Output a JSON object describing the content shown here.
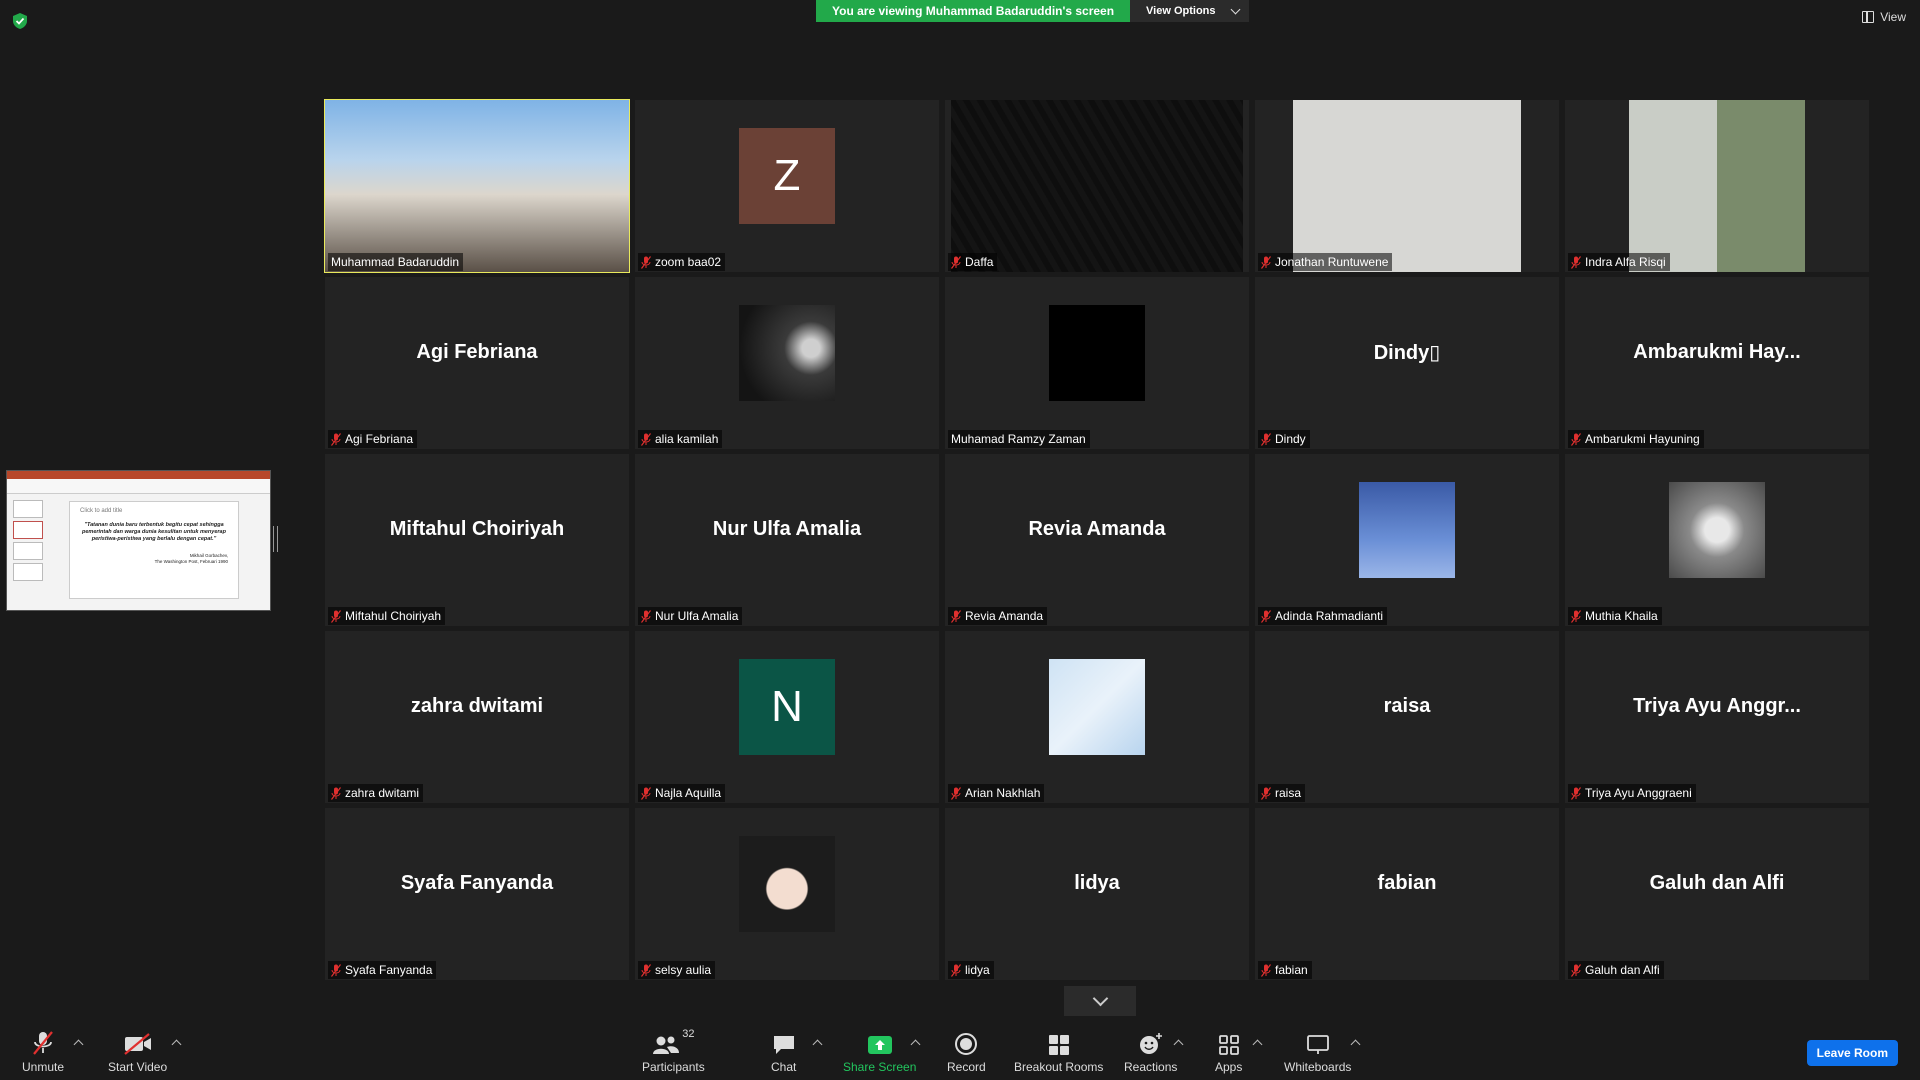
{
  "banner": {
    "message": "You are viewing Muhammad Badaruddin's screen",
    "view_options_label": "View Options"
  },
  "top_right": {
    "view_label": "View"
  },
  "shared_screen": {
    "placeholder_title": "Click to add title",
    "quote": "\"Tatanan dunia baru terbentuk begitu cepat sehingga pemerintah dan warga dunia kesulitan untuk menyerap peristiwa-peristiwa yang berlalu dengan cepat.\"",
    "cite_author": "Mikhail Gorbachev,",
    "cite_source": "The Washington Post, Februari 1990"
  },
  "participants": [
    {
      "label": "Muhammad Badaruddin",
      "type": "video",
      "muted": false,
      "active_speaker": true
    },
    {
      "label": "zoom baa02",
      "type": "avatar",
      "avatar_text": "Z",
      "avatar_color": "#6b4136",
      "muted": true
    },
    {
      "label": "Daffa",
      "type": "dark-video",
      "muted": true
    },
    {
      "label": "Jonathan Runtuwene",
      "type": "video",
      "muted": true
    },
    {
      "label": "Indra Alfa Risqi",
      "type": "video",
      "muted": true
    },
    {
      "label": "Agi Febriana",
      "type": "name",
      "center_name": "Agi Febriana",
      "muted": true
    },
    {
      "label": "alia kamilah",
      "type": "photo",
      "muted": true
    },
    {
      "label": "Muhamad Ramzy Zaman",
      "type": "black-avatar",
      "muted": false
    },
    {
      "label": "Dindy",
      "type": "name",
      "center_name": "Dindy▯",
      "muted": true
    },
    {
      "label": "Ambarukmi Hayuning",
      "type": "name",
      "center_name": "Ambarukmi  Hay...",
      "muted": true
    },
    {
      "label": "Miftahul Choiriyah",
      "type": "name",
      "center_name": "Miftahul Choiriyah",
      "muted": true
    },
    {
      "label": "Nur Ulfa Amalia",
      "type": "name",
      "center_name": "Nur Ulfa Amalia",
      "muted": true
    },
    {
      "label": "Revia Amanda",
      "type": "name",
      "center_name": "Revia Amanda",
      "muted": true
    },
    {
      "label": "Adinda Rahmadianti",
      "type": "photo",
      "muted": true
    },
    {
      "label": "Muthia Khaila",
      "type": "photo",
      "muted": true
    },
    {
      "label": "zahra dwitami",
      "type": "name",
      "center_name": "zahra dwitami",
      "muted": true
    },
    {
      "label": "Najla Aquilla",
      "type": "avatar",
      "avatar_text": "N",
      "avatar_color": "#0b5546",
      "muted": true
    },
    {
      "label": "Arian Nakhlah",
      "type": "photo",
      "muted": true
    },
    {
      "label": "raisa",
      "type": "name",
      "center_name": "raisa",
      "muted": true
    },
    {
      "label": "Triya Ayu Anggraeni",
      "type": "name",
      "center_name": "Triya  Ayu  Anggr...",
      "muted": true
    },
    {
      "label": "Syafa Fanyanda",
      "type": "name",
      "center_name": "Syafa Fanyanda",
      "muted": true
    },
    {
      "label": "selsy aulia",
      "type": "photo",
      "muted": true
    },
    {
      "label": "lidya",
      "type": "name",
      "center_name": "lidya",
      "muted": true
    },
    {
      "label": "fabian",
      "type": "name",
      "center_name": "fabian",
      "muted": true
    },
    {
      "label": "Galuh dan Alfi",
      "type": "name",
      "center_name": "Galuh dan Alfi",
      "muted": true
    }
  ],
  "toolbar": {
    "unmute": "Unmute",
    "start_video": "Start Video",
    "participants": "Participants",
    "participant_count": "32",
    "chat": "Chat",
    "share_screen": "Share Screen",
    "record": "Record",
    "breakout_rooms": "Breakout Rooms",
    "reactions": "Reactions",
    "apps": "Apps",
    "whiteboards": "Whiteboards",
    "leave": "Leave Room"
  },
  "colors": {
    "banner_green": "#22a94a",
    "active_speaker_border": "#e9ea5c",
    "share_green": "#22c55e",
    "leave_blue": "#0e71eb",
    "muted_red": "#e0302f"
  }
}
